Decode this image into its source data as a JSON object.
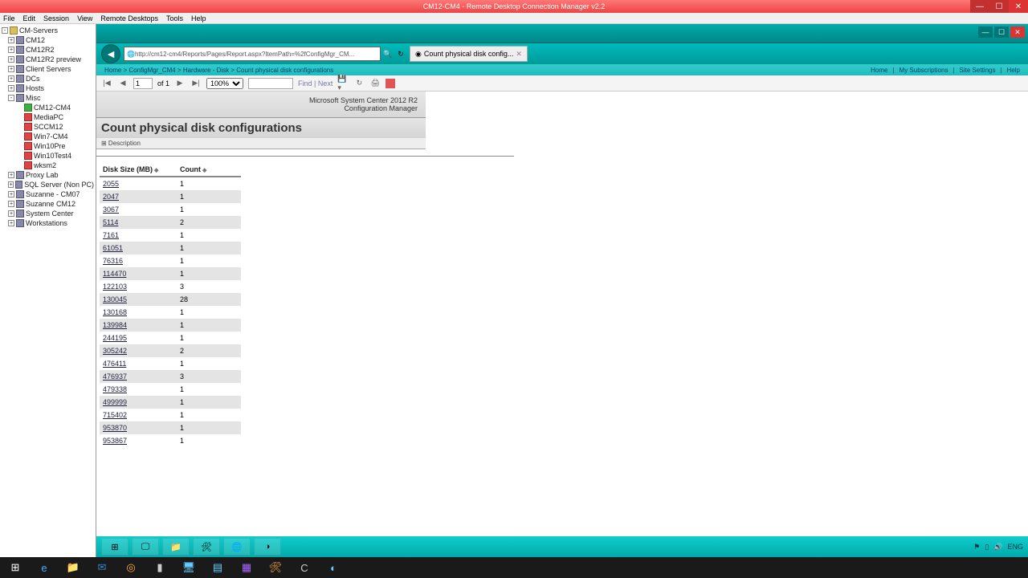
{
  "window": {
    "title": "CM12-CM4 - Remote Desktop Connection Manager v2.2"
  },
  "menu": [
    "File",
    "Edit",
    "Session",
    "View",
    "Remote Desktops",
    "Tools",
    "Help"
  ],
  "tree": {
    "root": "CM-Servers",
    "items": [
      {
        "label": "CM12",
        "lv": 1,
        "ico": "srv",
        "exp": "+"
      },
      {
        "label": "CM12R2",
        "lv": 1,
        "ico": "srv",
        "exp": "+"
      },
      {
        "label": "CM12R2 preview",
        "lv": 1,
        "ico": "srv",
        "exp": "+"
      },
      {
        "label": "Client Servers",
        "lv": 1,
        "ico": "srv",
        "exp": "+"
      },
      {
        "label": "DCs",
        "lv": 1,
        "ico": "srv",
        "exp": "+"
      },
      {
        "label": "Hosts",
        "lv": 1,
        "ico": "srv",
        "exp": "+"
      },
      {
        "label": "Misc",
        "lv": 1,
        "ico": "srv",
        "exp": "-"
      },
      {
        "label": "CM12-CM4",
        "lv": 2,
        "ico": "grn",
        "exp": ""
      },
      {
        "label": "MediaPC",
        "lv": 2,
        "ico": "red",
        "exp": ""
      },
      {
        "label": "SCCM12",
        "lv": 2,
        "ico": "red",
        "exp": ""
      },
      {
        "label": "Win7-CM4",
        "lv": 2,
        "ico": "red",
        "exp": ""
      },
      {
        "label": "Win10Pre",
        "lv": 2,
        "ico": "red",
        "exp": ""
      },
      {
        "label": "Win10Test4",
        "lv": 2,
        "ico": "red",
        "exp": ""
      },
      {
        "label": "wksm2",
        "lv": 2,
        "ico": "red",
        "exp": ""
      },
      {
        "label": "Proxy Lab",
        "lv": 1,
        "ico": "srv",
        "exp": "+"
      },
      {
        "label": "SQL Server (Non PC)",
        "lv": 1,
        "ico": "srv",
        "exp": "+"
      },
      {
        "label": "Suzanne - CM07",
        "lv": 1,
        "ico": "srv",
        "exp": "+"
      },
      {
        "label": "Suzanne CM12",
        "lv": 1,
        "ico": "srv",
        "exp": "+"
      },
      {
        "label": "System Center",
        "lv": 1,
        "ico": "srv",
        "exp": "+"
      },
      {
        "label": "Workstations",
        "lv": 1,
        "ico": "srv",
        "exp": "+"
      }
    ]
  },
  "browser": {
    "url": "http://cm12-cm4/Reports/Pages/Report.aspx?ItemPath=%2fConfigMgr_CM...",
    "tab_label": "Count physical disk config...",
    "crumb": "Home > ConfigMgr_CM4 > Hardware - Disk > Count physical disk configurations",
    "right_links": [
      "Home",
      "My Subscriptions",
      "Site Settings",
      "Help"
    ]
  },
  "viewer": {
    "page_current": "1",
    "page_of": "of 1",
    "zoom": "100%",
    "find_placeholder": "Find | Next"
  },
  "report": {
    "product_line1": "Microsoft System Center 2012 R2",
    "product_line2": "Configuration Manager",
    "title": "Count physical disk configurations",
    "desc_label": "⊞ Description",
    "col_size": "Disk Size (MB)",
    "col_count": "Count",
    "rows": [
      {
        "size": "2055",
        "count": "1"
      },
      {
        "size": "2047",
        "count": "1"
      },
      {
        "size": "3067",
        "count": "1"
      },
      {
        "size": "5114",
        "count": "2"
      },
      {
        "size": "7161",
        "count": "1"
      },
      {
        "size": "61051",
        "count": "1"
      },
      {
        "size": "76316",
        "count": "1"
      },
      {
        "size": "114470",
        "count": "1"
      },
      {
        "size": "122103",
        "count": "3"
      },
      {
        "size": "130045",
        "count": "28"
      },
      {
        "size": "130168",
        "count": "1"
      },
      {
        "size": "139984",
        "count": "1"
      },
      {
        "size": "244195",
        "count": "1"
      },
      {
        "size": "305242",
        "count": "2"
      },
      {
        "size": "476411",
        "count": "1"
      },
      {
        "size": "476937",
        "count": "3"
      },
      {
        "size": "479338",
        "count": "1"
      },
      {
        "size": "499999",
        "count": "1"
      },
      {
        "size": "715402",
        "count": "1"
      },
      {
        "size": "953870",
        "count": "1"
      },
      {
        "size": "953867",
        "count": "1"
      }
    ]
  },
  "rdp_tray": {
    "lang": "ENG"
  }
}
